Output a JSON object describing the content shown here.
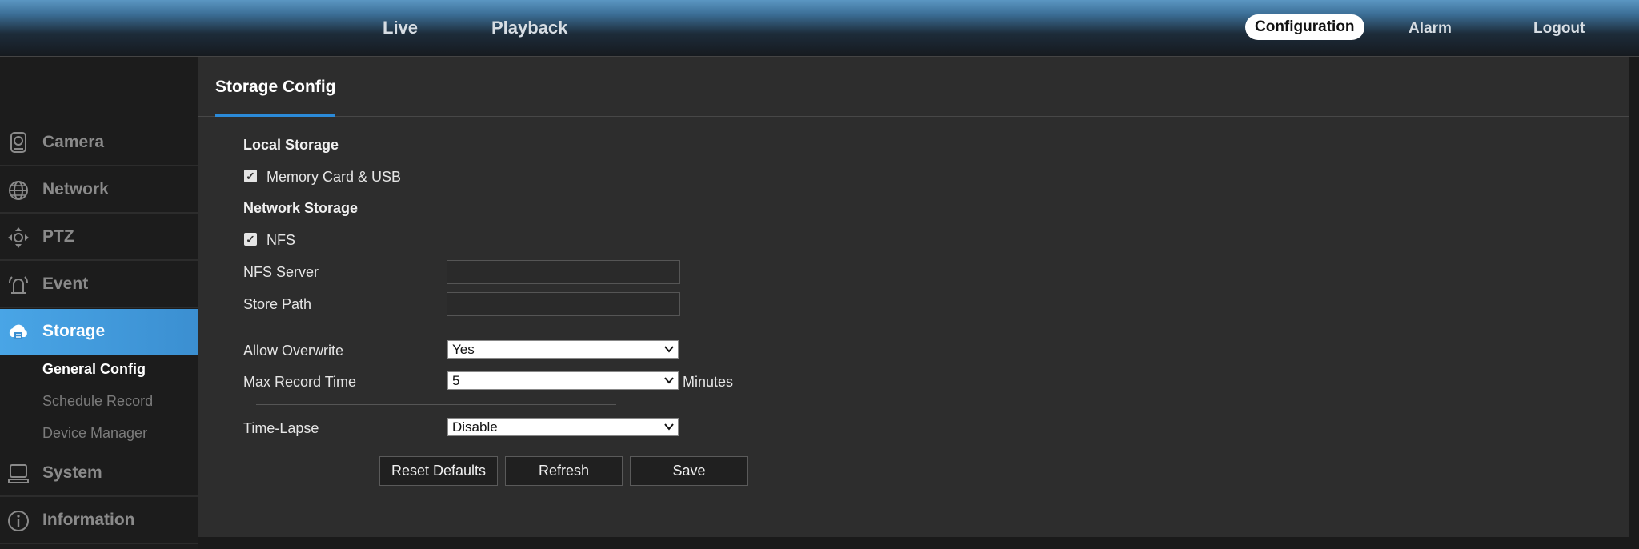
{
  "topnav": {
    "live": "Live",
    "playback": "Playback",
    "configuration": "Configuration",
    "alarm": "Alarm",
    "logout": "Logout"
  },
  "sidebar": {
    "items": [
      {
        "label": "Camera",
        "icon": "camera-icon"
      },
      {
        "label": "Network",
        "icon": "network-icon"
      },
      {
        "label": "PTZ",
        "icon": "ptz-icon"
      },
      {
        "label": "Event",
        "icon": "event-icon"
      },
      {
        "label": "Storage",
        "icon": "storage-icon",
        "active": true
      },
      {
        "label": "System",
        "icon": "system-icon"
      },
      {
        "label": "Information",
        "icon": "information-icon"
      }
    ],
    "subitems": [
      {
        "label": "General Config",
        "active": true
      },
      {
        "label": "Schedule Record"
      },
      {
        "label": "Device Manager"
      }
    ]
  },
  "panel": {
    "title": "Storage Config",
    "local_storage": {
      "title": "Local Storage",
      "memory_card_label": "Memory Card & USB",
      "memory_card_checked": true
    },
    "network_storage": {
      "title": "Network Storage",
      "nfs_label": "NFS",
      "nfs_checked": true,
      "nfs_server_label": "NFS Server",
      "nfs_server_value": "",
      "store_path_label": "Store Path",
      "store_path_value": ""
    },
    "allow_overwrite": {
      "label": "Allow Overwrite",
      "value": "Yes"
    },
    "max_record_time": {
      "label": "Max Record Time",
      "value": "5",
      "unit": "Minutes"
    },
    "time_lapse": {
      "label": "Time-Lapse",
      "value": "Disable"
    },
    "buttons": {
      "reset": "Reset Defaults",
      "refresh": "Refresh",
      "save": "Save"
    }
  },
  "colors": {
    "accent": "#3b8fd1",
    "background": "#2d2d2d",
    "sidebar": "#1c1c1c"
  }
}
